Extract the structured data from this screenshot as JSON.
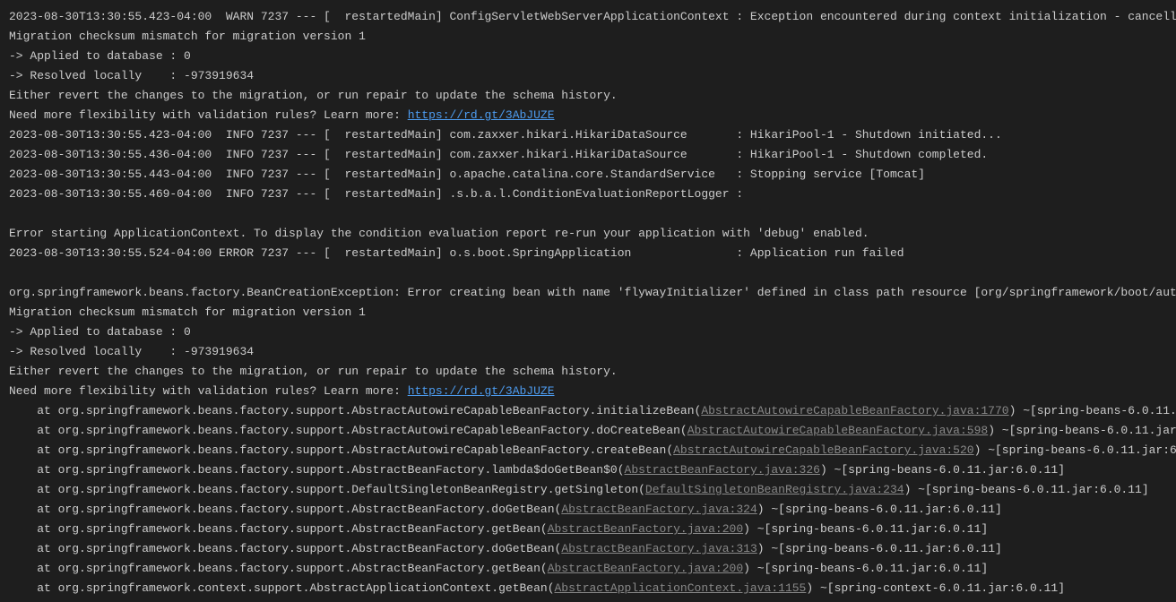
{
  "lines": [
    {
      "type": "plain",
      "text": "2023-08-30T13:30:55.423-04:00  WARN 7237 --- [  restartedMain] ConfigServletWebServerApplicationContext : Exception encountered during context initialization - cancelli"
    },
    {
      "type": "plain",
      "text": "Migration checksum mismatch for migration version 1"
    },
    {
      "type": "plain",
      "text": "-> Applied to database : 0"
    },
    {
      "type": "plain",
      "text": "-> Resolved locally    : -973919634"
    },
    {
      "type": "plain",
      "text": "Either revert the changes to the migration, or run repair to update the schema history."
    },
    {
      "type": "urlline",
      "prefix": "Need more flexibility with validation rules? Learn more: ",
      "url": "https://rd.gt/3AbJUZE"
    },
    {
      "type": "plain",
      "text": "2023-08-30T13:30:55.423-04:00  INFO 7237 --- [  restartedMain] com.zaxxer.hikari.HikariDataSource       : HikariPool-1 - Shutdown initiated..."
    },
    {
      "type": "plain",
      "text": "2023-08-30T13:30:55.436-04:00  INFO 7237 --- [  restartedMain] com.zaxxer.hikari.HikariDataSource       : HikariPool-1 - Shutdown completed."
    },
    {
      "type": "plain",
      "text": "2023-08-30T13:30:55.443-04:00  INFO 7237 --- [  restartedMain] o.apache.catalina.core.StandardService   : Stopping service [Tomcat]"
    },
    {
      "type": "plain",
      "text": "2023-08-30T13:30:55.469-04:00  INFO 7237 --- [  restartedMain] .s.b.a.l.ConditionEvaluationReportLogger :"
    },
    {
      "type": "plain",
      "text": ""
    },
    {
      "type": "plain",
      "text": "Error starting ApplicationContext. To display the condition evaluation report re-run your application with 'debug' enabled."
    },
    {
      "type": "plain",
      "text": "2023-08-30T13:30:55.524-04:00 ERROR 7237 --- [  restartedMain] o.s.boot.SpringApplication               : Application run failed"
    },
    {
      "type": "plain",
      "text": ""
    },
    {
      "type": "plain",
      "text": "org.springframework.beans.factory.BeanCreationException: Error creating bean with name 'flywayInitializer' defined in class path resource [org/springframework/boot/aut"
    },
    {
      "type": "plain",
      "text": "Migration checksum mismatch for migration version 1"
    },
    {
      "type": "plain",
      "text": "-> Applied to database : 0"
    },
    {
      "type": "plain",
      "text": "-> Resolved locally    : -973919634"
    },
    {
      "type": "plain",
      "text": "Either revert the changes to the migration, or run repair to update the schema history."
    },
    {
      "type": "urlline",
      "prefix": "Need more flexibility with validation rules? Learn more: ",
      "url": "https://rd.gt/3AbJUZE"
    },
    {
      "type": "trace",
      "prefix": "    at org.springframework.beans.factory.support.AbstractAutowireCapableBeanFactory.initializeBean(",
      "link": "AbstractAutowireCapableBeanFactory.java:1770",
      "suffix": ") ~[spring-beans-6.0.11."
    },
    {
      "type": "trace",
      "prefix": "    at org.springframework.beans.factory.support.AbstractAutowireCapableBeanFactory.doCreateBean(",
      "link": "AbstractAutowireCapableBeanFactory.java:598",
      "suffix": ") ~[spring-beans-6.0.11.jar"
    },
    {
      "type": "trace",
      "prefix": "    at org.springframework.beans.factory.support.AbstractAutowireCapableBeanFactory.createBean(",
      "link": "AbstractAutowireCapableBeanFactory.java:520",
      "suffix": ") ~[spring-beans-6.0.11.jar:6"
    },
    {
      "type": "trace",
      "prefix": "    at org.springframework.beans.factory.support.AbstractBeanFactory.lambda$doGetBean$0(",
      "link": "AbstractBeanFactory.java:326",
      "suffix": ") ~[spring-beans-6.0.11.jar:6.0.11]"
    },
    {
      "type": "trace",
      "prefix": "    at org.springframework.beans.factory.support.DefaultSingletonBeanRegistry.getSingleton(",
      "link": "DefaultSingletonBeanRegistry.java:234",
      "suffix": ") ~[spring-beans-6.0.11.jar:6.0.11]"
    },
    {
      "type": "trace",
      "prefix": "    at org.springframework.beans.factory.support.AbstractBeanFactory.doGetBean(",
      "link": "AbstractBeanFactory.java:324",
      "suffix": ") ~[spring-beans-6.0.11.jar:6.0.11]"
    },
    {
      "type": "trace",
      "prefix": "    at org.springframework.beans.factory.support.AbstractBeanFactory.getBean(",
      "link": "AbstractBeanFactory.java:200",
      "suffix": ") ~[spring-beans-6.0.11.jar:6.0.11]"
    },
    {
      "type": "trace",
      "prefix": "    at org.springframework.beans.factory.support.AbstractBeanFactory.doGetBean(",
      "link": "AbstractBeanFactory.java:313",
      "suffix": ") ~[spring-beans-6.0.11.jar:6.0.11]"
    },
    {
      "type": "trace",
      "prefix": "    at org.springframework.beans.factory.support.AbstractBeanFactory.getBean(",
      "link": "AbstractBeanFactory.java:200",
      "suffix": ") ~[spring-beans-6.0.11.jar:6.0.11]"
    },
    {
      "type": "trace",
      "prefix": "    at org.springframework.context.support.AbstractApplicationContext.getBean(",
      "link": "AbstractApplicationContext.java:1155",
      "suffix": ") ~[spring-context-6.0.11.jar:6.0.11]"
    }
  ]
}
